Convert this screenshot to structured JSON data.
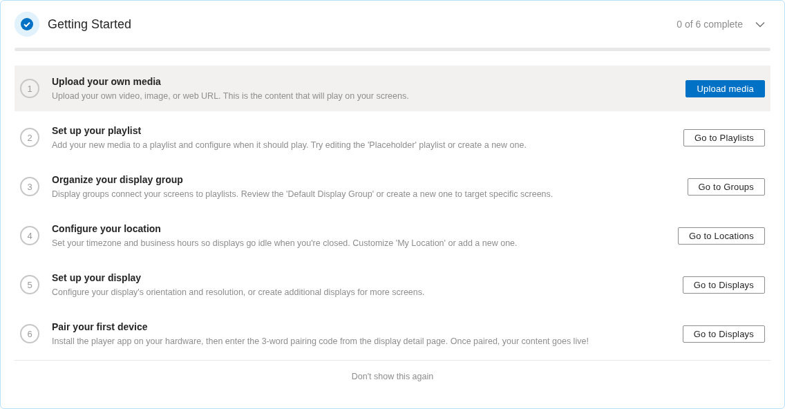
{
  "header": {
    "title": "Getting Started",
    "progress_text": "0 of 6 complete",
    "expanded": true
  },
  "progress": {
    "level": 0
  },
  "steps": [
    {
      "number": "1",
      "title": "Upload your own media",
      "description": "Upload your own video, image, or web URL. This is the content that will play on your screens.",
      "button": {
        "label": "Upload media",
        "kind": "primary"
      },
      "selected": true
    },
    {
      "number": "2",
      "title": "Set up your playlist",
      "description": "Add your new media to a playlist and configure when it should play. Try editing the 'Placeholder' playlist or create a new one.",
      "button": {
        "label": "Go to Playlists",
        "kind": "secondary"
      },
      "selected": false
    },
    {
      "number": "3",
      "title": "Organize your display group",
      "description": "Display groups connect your screens to playlists. Review the 'Default Display Group' or create a new one to target specific screens.",
      "button": {
        "label": "Go to Groups",
        "kind": "secondary"
      },
      "selected": false
    },
    {
      "number": "4",
      "title": "Configure your location",
      "description": "Set your timezone and business hours so displays go idle when you're closed. Customize 'My Location' or add a new one.",
      "button": {
        "label": "Go to Locations",
        "kind": "secondary"
      },
      "selected": false
    },
    {
      "number": "5",
      "title": "Set up your display",
      "description": "Configure your display's orientation and resolution, or create additional displays for more screens.",
      "button": {
        "label": "Go to Displays",
        "kind": "secondary"
      },
      "selected": false
    },
    {
      "number": "6",
      "title": "Pair your first device",
      "description": "Install the player app on your hardware, then enter the 3-word pairing code from the display detail page. Once paired, your content goes live!",
      "button": {
        "label": "Go to Displays",
        "kind": "secondary"
      },
      "selected": false
    }
  ],
  "footer": {
    "link": "Don't show this again"
  }
}
